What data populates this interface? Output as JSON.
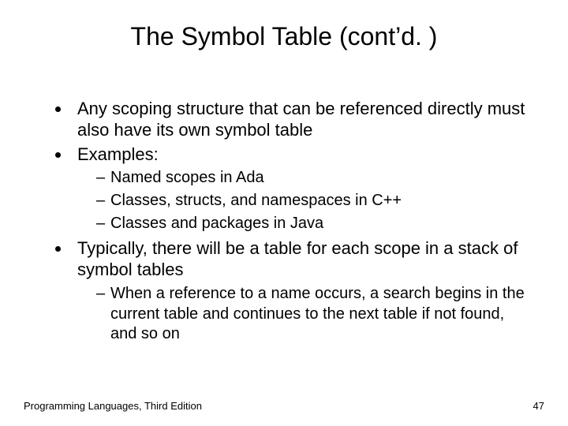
{
  "slide": {
    "title": "The Symbol Table (cont’d. )",
    "bullets": [
      {
        "text": "Any scoping structure that can be referenced directly must also have its own symbol table",
        "sub": []
      },
      {
        "text": "Examples:",
        "sub": [
          "Named scopes in Ada",
          "Classes, structs, and namespaces in C++",
          "Classes and packages in Java"
        ]
      },
      {
        "text": "Typically, there will be a table for each scope in a stack of symbol tables",
        "sub": [
          "When a reference to a name occurs, a search begins in the current table and continues to the next table if not found, and so on"
        ]
      }
    ],
    "footer_left": "Programming Languages, Third Edition",
    "footer_right": "47"
  }
}
